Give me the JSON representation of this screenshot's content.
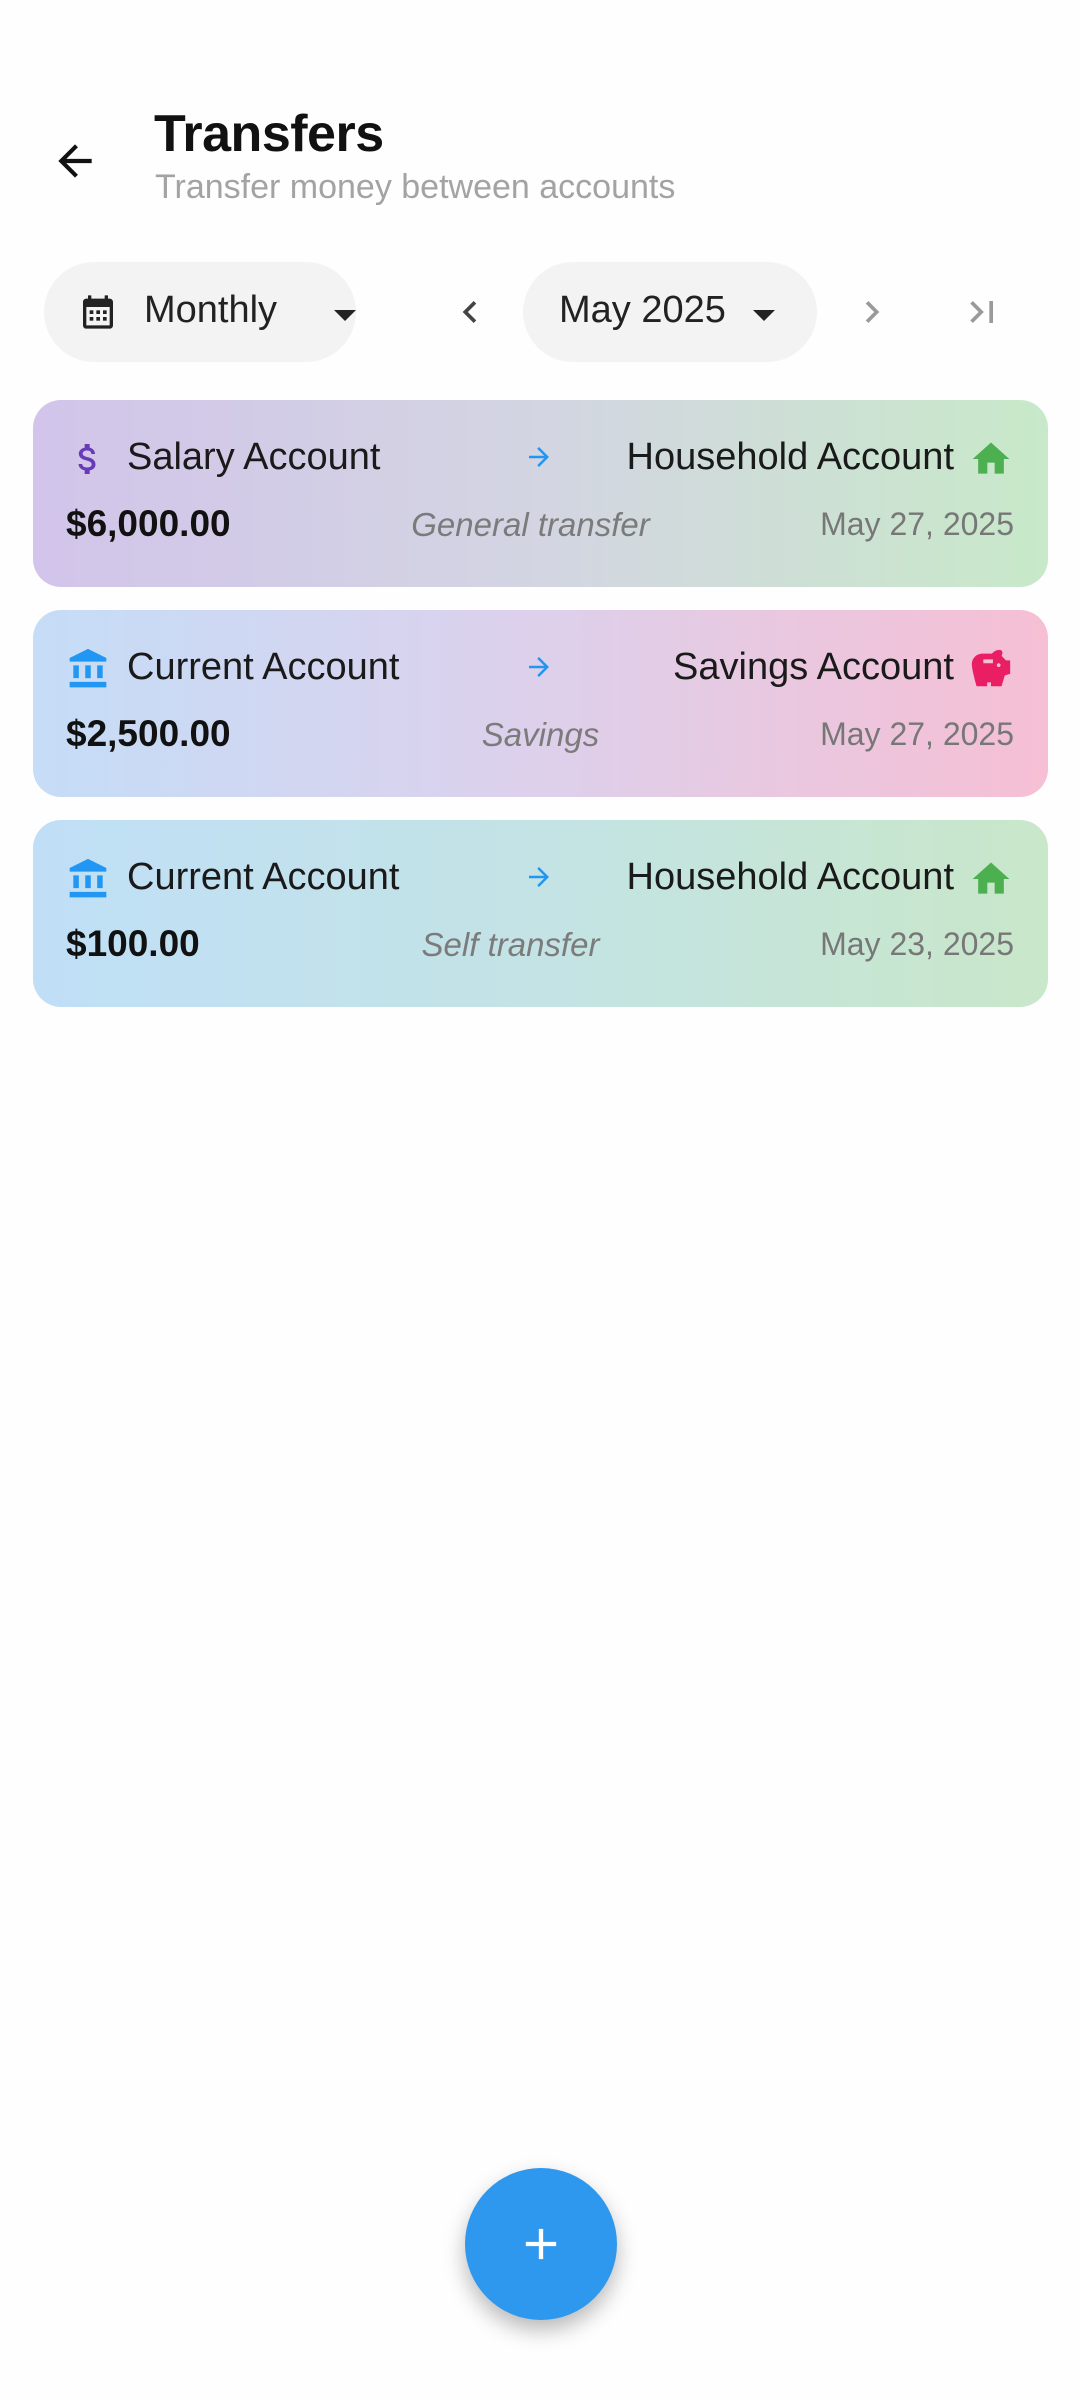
{
  "header": {
    "title": "Transfers",
    "subtitle": "Transfer money between accounts"
  },
  "controls": {
    "period": "Monthly",
    "month": "May 2025"
  },
  "transfers": [
    {
      "from": "Salary Account",
      "from_icon": "dollar-icon",
      "to": "Household Account",
      "to_icon": "home-icon",
      "amount": "$6,000.00",
      "description": "General transfer",
      "date": "May 27, 2025"
    },
    {
      "from": "Current Account",
      "from_icon": "bank-icon",
      "to": "Savings Account",
      "to_icon": "piggy-bank-icon",
      "amount": "$2,500.00",
      "description": "Savings",
      "date": "May 27, 2025"
    },
    {
      "from": "Current Account",
      "from_icon": "bank-icon",
      "to": "Household Account",
      "to_icon": "home-icon",
      "amount": "$100.00",
      "description": "Self transfer",
      "date": "May 23, 2025"
    }
  ],
  "colors": {
    "accent": "#2e97ee",
    "home_icon": "#4caf50",
    "piggy_icon": "#e91e63",
    "dollar_icon": "#673ab7",
    "bank_icon": "#2196f3"
  }
}
